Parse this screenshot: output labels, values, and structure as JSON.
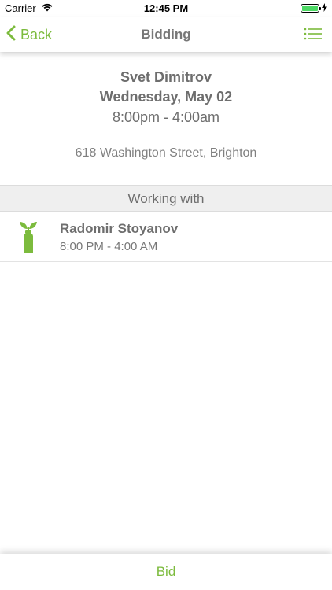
{
  "status_bar": {
    "carrier": "Carrier",
    "time": "12:45 PM",
    "battery_level": 1.0
  },
  "nav": {
    "back_label": "Back",
    "title": "Bidding",
    "menu_icon": "list-icon"
  },
  "event": {
    "client_name": "Svet Dimitrov",
    "date": "Wednesday, May 02",
    "time_range": "8:00pm - 4:00am",
    "address": "618 Washington Street, Brighton"
  },
  "section": {
    "header": "Working with"
  },
  "workers": [
    {
      "name": "Radomir Stoyanov",
      "time_range": "8:00 PM - 4:00 AM",
      "icon": "bottle-sprout-icon"
    }
  ],
  "bottom_bar": {
    "bid_label": "Bid"
  },
  "colors": {
    "accent": "#7cbb3d",
    "text": "#6e6e6e",
    "section_bg": "#efefef"
  }
}
